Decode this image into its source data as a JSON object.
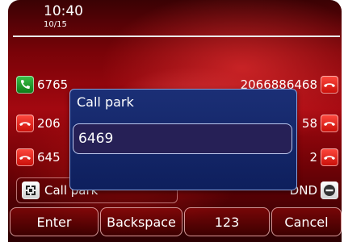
{
  "status_bar": {
    "time": "10:40",
    "date": "10/15"
  },
  "lines": [
    {
      "left_label": "6765",
      "left_icon": "phone-green-icon",
      "right_label": "2066886468",
      "right_icon": "hangup-red-icon"
    },
    {
      "left_label": "206",
      "left_icon": "hangup-red-icon",
      "right_label": "58",
      "right_icon": "hangup-red-icon"
    },
    {
      "left_label": "645",
      "left_icon": "hangup-red-icon",
      "right_label": "2",
      "right_icon": "hangup-red-icon"
    }
  ],
  "keys": {
    "call_park": {
      "label": "Call park",
      "icon": "call-park-icon"
    },
    "dnd": {
      "label": "DND",
      "icon": "dnd-minus-icon"
    }
  },
  "dialog": {
    "title": "Call park",
    "input_value": "6469"
  },
  "softkeys": [
    "Enter",
    "Backspace",
    "123",
    "Cancel"
  ],
  "colors": {
    "dialog_bg": "#1b2f76",
    "screen_accent": "#a30810",
    "phone_green": "#3cc24a",
    "hangup_red": "#ff4a3f"
  }
}
